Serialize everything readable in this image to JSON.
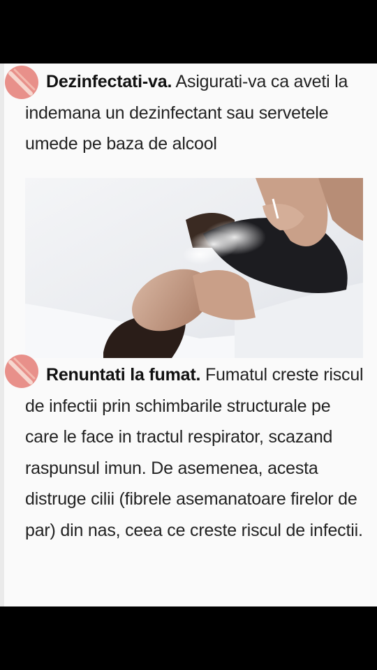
{
  "tips": [
    {
      "title": "Dezinfectati-va.",
      "body": " Asigurati-va ca aveti la indemana un dezinfectant sau servetele umede pe baza de alcool",
      "badge_icon": "prohibition-icon"
    },
    {
      "title": "Renuntati la fumat.",
      "body": " Fumatul creste riscul de infectii prin schimbarile structurale pe care le face in tractul respirator, scazand raspunsul imun. De asemenea, acesta distruge cilii (fibrele asemanatoare firelor de par) din nas, ceea ce creste riscul de infectii.",
      "badge_icon": "prohibition-icon"
    }
  ],
  "photo": {
    "subject": "woman-smoking-photo"
  },
  "colors": {
    "badge_fill": "#e8908a",
    "badge_stripe": "#f6d7cf",
    "background": "#fafafa",
    "text": "#222222"
  }
}
